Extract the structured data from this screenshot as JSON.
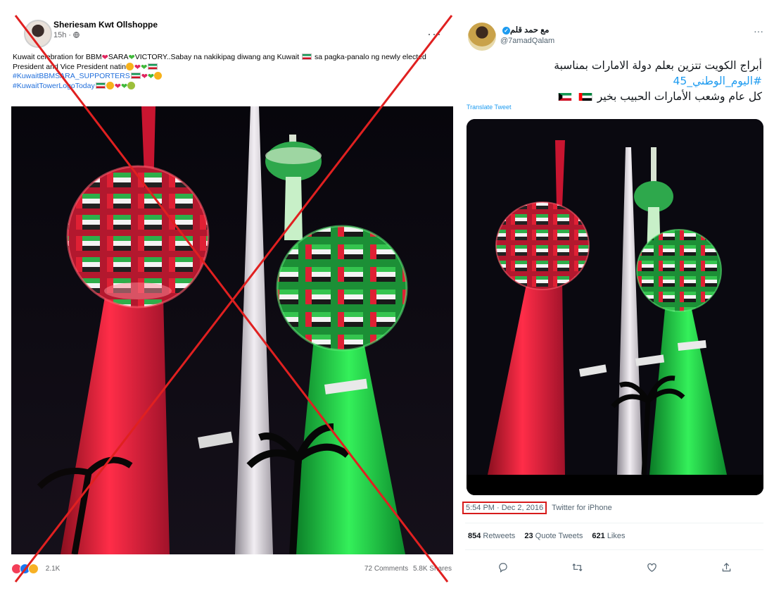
{
  "facebook_post": {
    "author": "Sheriesam Kwt Ollshoppe",
    "time": "15h",
    "visibility_icon": "globe-icon",
    "more_icon": "ellipsis-icon",
    "text_line1_a": "Kuwait celebration for BBM",
    "text_line1_b": "SARA",
    "text_line1_c": "VICTORY..Sabay na nakikipag diwang ang Kuwait",
    "text_line1_d": "sa pagka-panalo ng newly elected",
    "text_line2": "President and Vice President natin",
    "hashtag1": "#KuwaitBBMSARA_SUPPORTERS",
    "hashtag2": "#KuwaitTowerLogoToday",
    "reaction_count": "2.1K",
    "comments": "72 Comments",
    "shares": "5.8K Shares"
  },
  "tweet": {
    "display_name": "مع حمد قلم",
    "handle": "@7amadQalam",
    "more_icon": "ellipsis-icon",
    "line1": "أبراج الكويت تتزين بعلم دولة الامارات بمناسبة",
    "hashtag": "#اليوم_الوطني_45",
    "line3": "كل عام وشعب الأمارات الحبيب بخير",
    "translate": "Translate Tweet",
    "timestamp": "5:54 PM · Dec 2, 2016",
    "client": "Twitter for iPhone",
    "retweets_n": "854",
    "retweets_label": "Retweets",
    "quotes_n": "23",
    "quotes_label": "Quote Tweets",
    "likes_n": "621",
    "likes_label": "Likes",
    "action_icons": [
      "reply-icon",
      "retweet-icon",
      "like-icon",
      "share-icon"
    ]
  },
  "colors": {
    "false_marker": "#e02020",
    "timestamp_highlight": "#d71b1b",
    "facebook_link": "#216fdb",
    "twitter_blue": "#1d9bf0",
    "tower_red": "#e0193a",
    "tower_green": "#19c43a"
  }
}
